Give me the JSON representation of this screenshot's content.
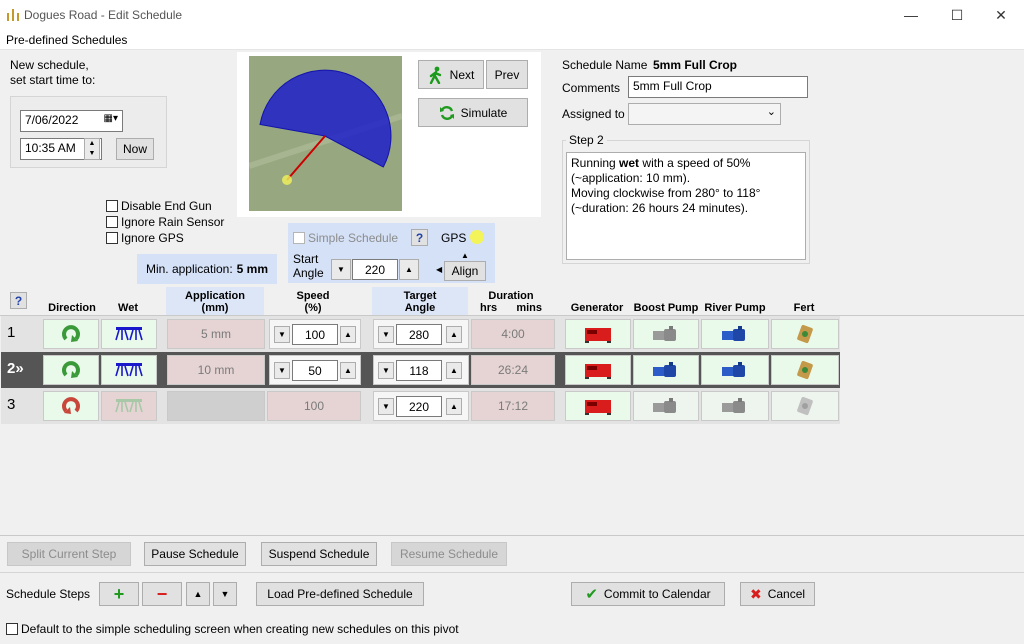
{
  "window": {
    "title": "Dogues Road - Edit Schedule",
    "minimize": "—",
    "maximize": "☐",
    "close": "✕"
  },
  "menu": {
    "predefined": "Pre-defined Schedules"
  },
  "start": {
    "label_line1": "New schedule,",
    "label_line2": "set start time to:",
    "date": "7/06/2022",
    "time": "10:35 AM",
    "now_button": "Now"
  },
  "map": {
    "arc_start_deg": 280,
    "arc_end_deg": 118
  },
  "nav": {
    "next": "Next",
    "prev": "Prev",
    "simulate": "Simulate"
  },
  "schedule": {
    "name_label": "Schedule Name",
    "name_value": "5mm Full Crop",
    "comments_label": "Comments",
    "comments_value": "5mm Full Crop",
    "assigned_label": "Assigned to",
    "assigned_value": ""
  },
  "step_box": {
    "title": "Step 2",
    "line1_pre": "Running ",
    "line1_bold": "wet",
    "line1_post": " with a speed of 50%",
    "line2": "(~application: 10 mm).",
    "line3": "Moving clockwise from 280° to 118°",
    "line4": "(~duration: 26 hours 24 minutes)."
  },
  "options": {
    "disable_end_gun": "Disable End Gun",
    "ignore_rain": "Ignore Rain Sensor",
    "ignore_gps": "Ignore GPS",
    "min_app_label": "Min. application:",
    "min_app_value": "5 mm",
    "simple_schedule": "Simple Schedule",
    "help": "?",
    "gps": "GPS",
    "start_angle_label1": "Start",
    "start_angle_label2": "Angle",
    "start_angle_value": "220",
    "align": "Align"
  },
  "table": {
    "help": "?",
    "headers": {
      "direction": "Direction",
      "wet": "Wet",
      "application": "Application",
      "application_unit": "(mm)",
      "speed": "Speed",
      "speed_unit": "(%)",
      "target": "Target",
      "target_unit": "Angle",
      "duration": "Duration",
      "hrs": "hrs",
      "mins": "mins",
      "generator": "Generator",
      "boost": "Boost Pump",
      "river": "River Pump",
      "fert": "Fert"
    },
    "rows": [
      {
        "num": "1",
        "application": "5 mm",
        "speed": "100",
        "target": "280",
        "duration": "4:00"
      },
      {
        "num": "2»",
        "application": "10 mm",
        "speed": "50",
        "target": "118",
        "duration": "26:24"
      },
      {
        "num": "3",
        "application": "",
        "speed": "100",
        "target": "220",
        "duration": "17:12"
      }
    ]
  },
  "actions": {
    "split": "Split Current Step",
    "pause": "Pause Schedule",
    "suspend": "Suspend Schedule",
    "resume": "Resume Schedule"
  },
  "footer": {
    "steps_label": "Schedule Steps",
    "add": "+",
    "remove": "−",
    "up": "▲",
    "down": "▼",
    "load": "Load Pre-defined Schedule",
    "commit": "Commit to Calendar",
    "cancel": "Cancel",
    "default_check": "Default to the simple scheduling screen when creating new schedules on this pivot"
  },
  "colors": {
    "accent_green": "#eafaea",
    "row_selected": "#555555",
    "map_blue": "#1a1acc"
  }
}
